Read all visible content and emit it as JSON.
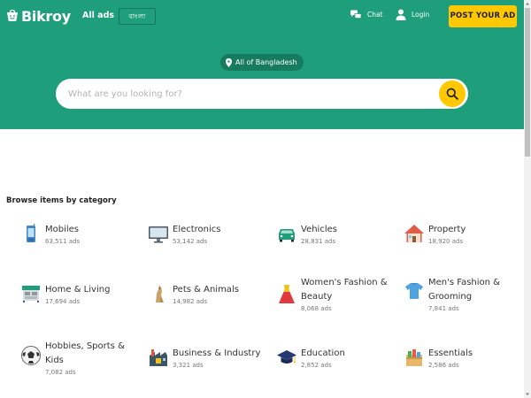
{
  "header": {
    "logo_text": "Bikroy",
    "all_ads": "All ads",
    "language": "বাংলা",
    "chat": "Chat",
    "login": "Login",
    "post_ad": "POST YOUR AD"
  },
  "hero": {
    "location": "All of Bangladesh",
    "search_placeholder": "What are you looking for?"
  },
  "browse": {
    "title": "Browse items by category",
    "categories": [
      {
        "name": "Mobiles",
        "count": "63,511 ads",
        "icon": "mobile-phone-icon"
      },
      {
        "name": "Electronics",
        "count": "53,142 ads",
        "icon": "monitor-icon"
      },
      {
        "name": "Vehicles",
        "count": "28,831 ads",
        "icon": "car-icon"
      },
      {
        "name": "Property",
        "count": "18,920 ads",
        "icon": "house-icon"
      },
      {
        "name": "Home & Living",
        "count": "17,694 ads",
        "icon": "furniture-icon"
      },
      {
        "name": "Pets & Animals",
        "count": "14,982 ads",
        "icon": "pet-icon"
      },
      {
        "name": "Women's Fashion & Beauty",
        "count": "8,068 ads",
        "icon": "dress-icon"
      },
      {
        "name": "Men's Fashion & Grooming",
        "count": "7,841 ads",
        "icon": "tshirt-icon"
      },
      {
        "name": "Hobbies, Sports & Kids",
        "count": "7,082 ads",
        "icon": "football-icon"
      },
      {
        "name": "Business & Industry",
        "count": "3,321 ads",
        "icon": "factory-icon"
      },
      {
        "name": "Education",
        "count": "2,852 ads",
        "icon": "graduation-cap-icon"
      },
      {
        "name": "Essentials",
        "count": "2,586 ads",
        "icon": "grocery-icon"
      }
    ]
  },
  "colors": {
    "brand_green": "#1e9e7a",
    "accent_yellow": "#ffc800"
  }
}
